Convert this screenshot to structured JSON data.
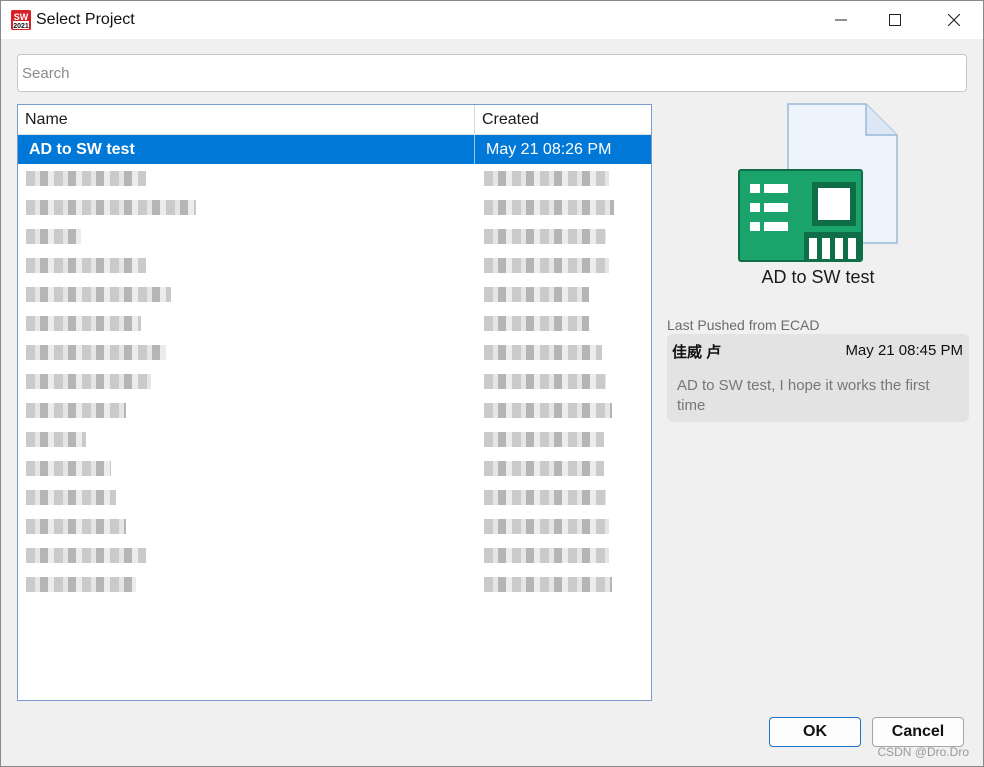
{
  "window": {
    "title": "Select Project",
    "app_icon": "solidworks-2021-icon"
  },
  "search": {
    "placeholder": "Search",
    "value": ""
  },
  "table": {
    "columns": [
      "Name",
      "Created"
    ],
    "rows": [
      {
        "name": "AD to SW test",
        "created": "May 21 08:26 PM",
        "selected": true
      }
    ],
    "obscured_row_count": 15
  },
  "preview": {
    "icon": "pcb-project-file-icon",
    "project_name": "AD to SW test",
    "last_pushed_label": "Last Pushed from ECAD",
    "commit": {
      "author": "佳威 卢",
      "date": "May 21 08:45 PM",
      "message": "AD to SW test, I hope it works the first time"
    }
  },
  "buttons": {
    "ok": "OK",
    "cancel": "Cancel"
  },
  "watermark": "CSDN @Dro.Dro",
  "colors": {
    "selection": "#0078d7",
    "pcb_green": "#1aa36b",
    "ok_border": "#1f74c8"
  }
}
